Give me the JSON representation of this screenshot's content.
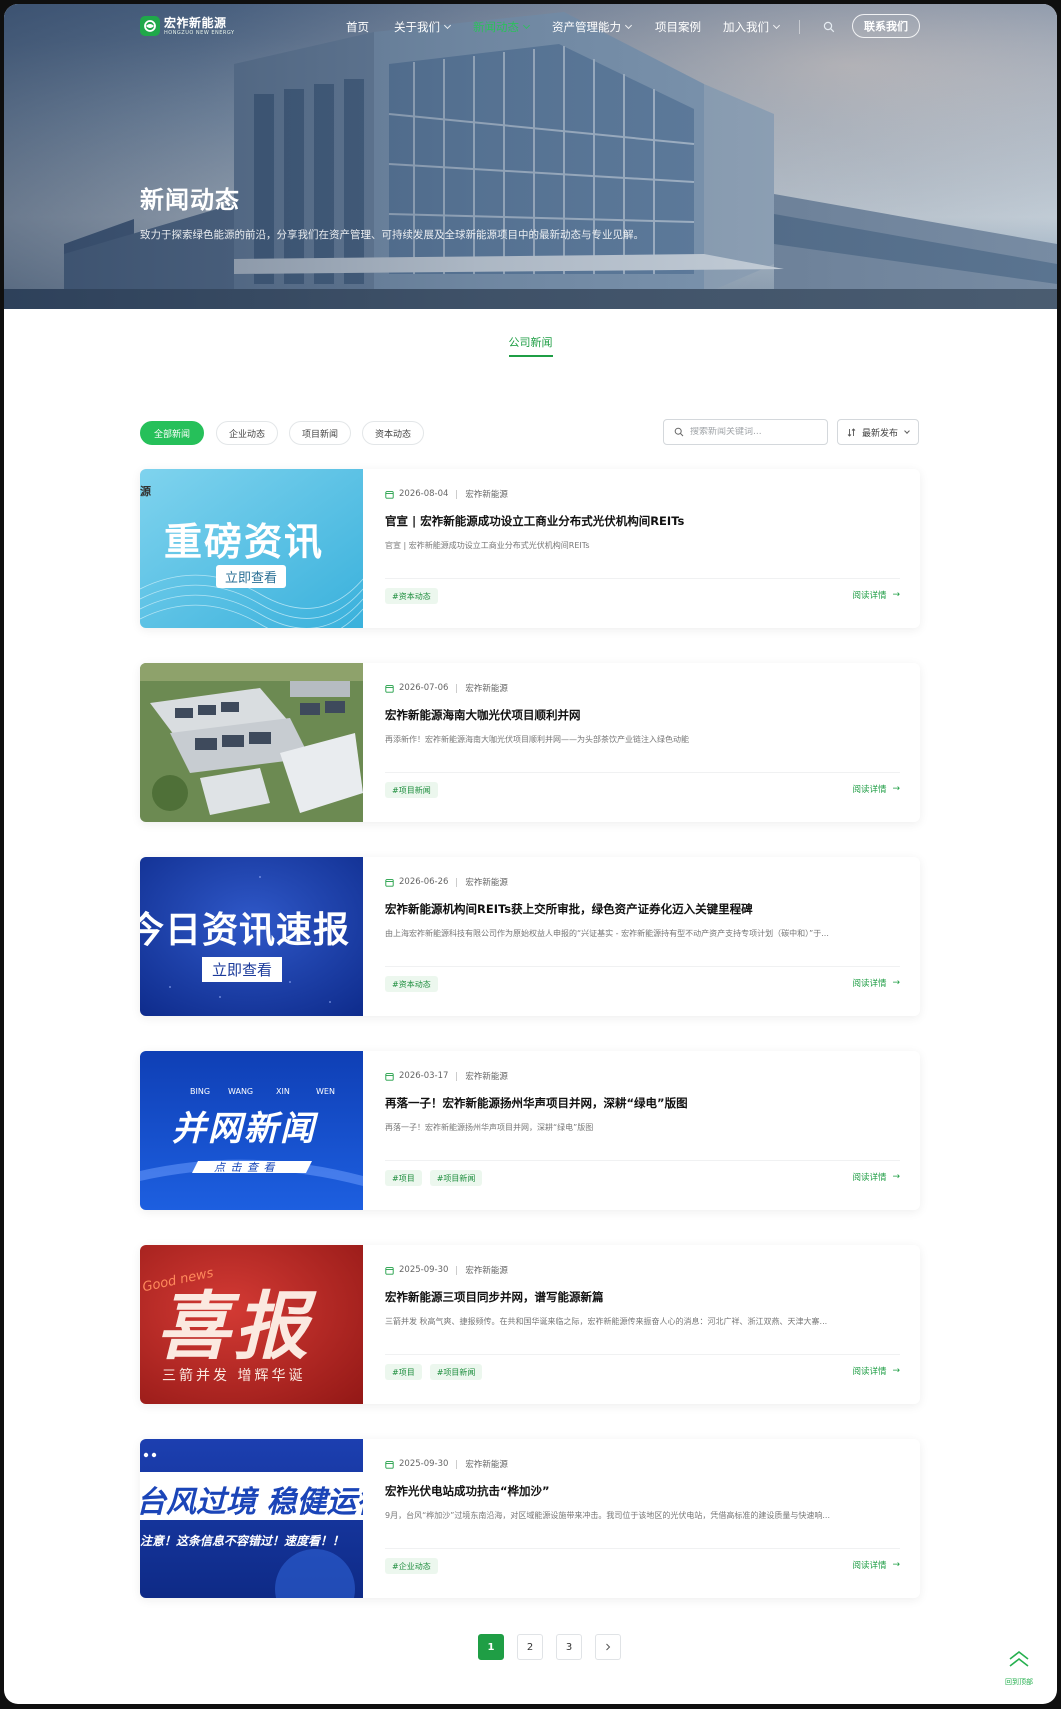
{
  "brand": {
    "name_cn": "宏祚新能源",
    "name_en": "HONGZUO NEW ENERGY",
    "accent": "#1f9e45",
    "accent_light": "#26c05a"
  },
  "nav": {
    "items": [
      {
        "label": "首页",
        "dropdown": false,
        "active": false
      },
      {
        "label": "关于我们",
        "dropdown": true,
        "active": false
      },
      {
        "label": "新闻动态",
        "dropdown": true,
        "active": true
      },
      {
        "label": "资产管理能力",
        "dropdown": true,
        "active": false
      },
      {
        "label": "项目案例",
        "dropdown": false,
        "active": false
      },
      {
        "label": "加入我们",
        "dropdown": true,
        "active": false
      }
    ],
    "search_icon": "search-icon",
    "contact_label": "联系我们"
  },
  "hero": {
    "title": "新闻动态",
    "subtitle": "致力于探索绿色能源的前沿，分享我们在资产管理、可持续发展及全球新能源项目中的最新动态与专业见解。"
  },
  "section_tab": "公司新闻",
  "filters": {
    "chips": [
      "全部新闻",
      "企业动态",
      "项目新闻",
      "资本动态"
    ],
    "active_index": 0,
    "search_placeholder": "搜索新闻关键词...",
    "sort_label": "最新发布"
  },
  "news": [
    {
      "date": "2026-08-04",
      "source": "宏祚新能源",
      "title": "官宣 | 宏祚新能源成功设立工商业分布式光伏机构间REITs",
      "desc": "官宣 | 宏祚新能源成功设立工商业分布式光伏机构间REITs",
      "tags": [
        "#资本动态"
      ],
      "read_more": "阅读详情",
      "thumb": {
        "kind": "banner-light",
        "line1": "重磅资讯",
        "line2": "立即查看",
        "corner": "源"
      }
    },
    {
      "date": "2026-07-06",
      "source": "宏祚新能源",
      "title": "宏祚新能源海南大咖光伏项目顺利并网",
      "desc": "再添新作！宏祚新能源海南大咖光伏项目顺利并网——为头部茶饮产业链注入绿色动能",
      "tags": [
        "#项目新闻"
      ],
      "read_more": "阅读详情",
      "thumb": {
        "kind": "aerial"
      }
    },
    {
      "date": "2026-06-26",
      "source": "宏祚新能源",
      "title": "宏祚新能源机构间REITs获上交所审批，绿色资产证券化迈入关键里程碑",
      "desc": "由上海宏祚新能源科技有限公司作为原始权益人申报的“兴证基实 - 宏祚新能源持有型不动产资产支持专项计划（碳中和）”于...",
      "tags": [
        "#资本动态"
      ],
      "read_more": "阅读详情",
      "thumb": {
        "kind": "banner-blue",
        "line1": "今日资讯速报",
        "line2": "立即查看"
      }
    },
    {
      "date": "2026-03-17",
      "source": "宏祚新能源",
      "title": "再落一子！宏祚新能源扬州华声项目并网，深耕“绿电”版图",
      "desc": "再落一子！宏祚新能源扬州华声项目并网，深耕“绿电”版图",
      "tags": [
        "#项目",
        "#项目新闻"
      ],
      "read_more": "阅读详情",
      "thumb": {
        "kind": "banner-grid",
        "pinyin": [
          "BING",
          "WANG",
          "XIN",
          "WEN"
        ],
        "line1": "并网新闻",
        "line2": "点 击 查 看"
      }
    },
    {
      "date": "2025-09-30",
      "source": "宏祚新能源",
      "title": "宏祚新能源三项目同步并网，谱写能源新篇",
      "desc": "三箭并发 秋高气爽、捷报频传。在共和国华诞来临之际，宏祚新能源传来振奋人心的消息：河北广祥、浙江双燕、天津大寨...",
      "tags": [
        "#项目",
        "#项目新闻"
      ],
      "read_more": "阅读详情",
      "thumb": {
        "kind": "banner-red",
        "script": "Good news",
        "line1": "喜报",
        "line2": "三箭并发  增辉华诞"
      }
    },
    {
      "date": "2025-09-30",
      "source": "宏祚新能源",
      "title": "宏祚光伏电站成功抗击“桦加沙”",
      "desc": "9月，台风“桦加沙”过境东南沿海，对区域能源设施带来冲击。我司位于该地区的光伏电站，凭借高标准的建设质量与快速响...",
      "tags": [
        "#企业动态"
      ],
      "read_more": "阅读详情",
      "thumb": {
        "kind": "banner-typhoon",
        "line1": "台风过境 稳健运行",
        "line2": "注意！这条信息不容错过！速度看！！"
      }
    }
  ],
  "pagination": {
    "pages": [
      "1",
      "2",
      "3"
    ],
    "current": "1",
    "next_icon": "chevron-right-icon"
  },
  "back_to_top": "回到顶部"
}
